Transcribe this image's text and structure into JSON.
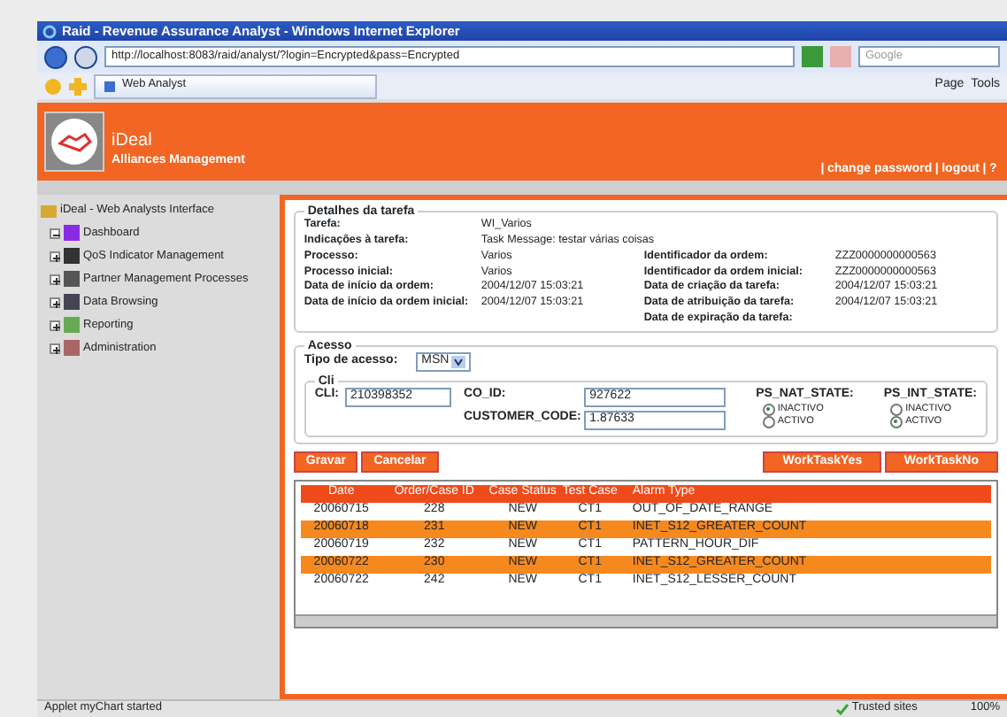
{
  "window": {
    "title": "Raid - Revenue Assurance Analyst - Windows Internet Explorer"
  },
  "address": {
    "url": "http://localhost:8083/raid/analyst/?login=Encrypted&pass=Encrypted",
    "search_placeholder": "Google"
  },
  "tab": {
    "label": "Web Analyst"
  },
  "toolbar": [
    "Page",
    "Tools"
  ],
  "header": {
    "brand": "iDeal",
    "subtitle": "Alliances Management",
    "links": [
      "change password",
      "logout",
      "?"
    ],
    "separator": "|"
  },
  "sidebar": {
    "root": "iDeal - Web Analysts Interface",
    "items": [
      {
        "label": "Dashboard",
        "expanded": true
      },
      {
        "label": "QoS Indicator Management",
        "expanded": false
      },
      {
        "label": "Partner Management Processes",
        "expanded": false
      },
      {
        "label": "Data Browsing",
        "expanded": false
      },
      {
        "label": "Reporting",
        "expanded": false
      },
      {
        "label": "Administration",
        "expanded": false
      }
    ]
  },
  "details": {
    "legend": "Detalhes da tarefa",
    "left": [
      {
        "label": "Tarefa:",
        "value": "WI_Varios"
      },
      {
        "label": "Indicações à tarefa:",
        "value": "Task Message: testar várias coisas"
      },
      {
        "label": "Processo:",
        "value": "Varios"
      },
      {
        "label": "Processo inicial:",
        "value": "Varios"
      },
      {
        "label": "Data de início da ordem:",
        "value": "2004/12/07 15:03:21"
      },
      {
        "label": "Data de início da ordem inicial:",
        "value": "2004/12/07 15:03:21"
      }
    ],
    "right": [
      {
        "label": "Identificador da ordem:",
        "value": "ZZZ0000000000563"
      },
      {
        "label": "Identificador da ordem inicial:",
        "value": "ZZZ0000000000563"
      },
      {
        "label": "Data de criação da tarefa:",
        "value": "2004/12/07 15:03:21"
      },
      {
        "label": "Data de atribuição da tarefa:",
        "value": "2004/12/07 15:03:21"
      },
      {
        "label": "Data de expiração da tarefa:"
      }
    ]
  },
  "access": {
    "legend": "Acesso",
    "type_label": "Tipo de acesso:",
    "type_value": "MSN",
    "cli": {
      "legend": "Cli",
      "cli_label": "CLI:",
      "cli_value": "210398352",
      "coid_label": "CO_ID:",
      "coid_value": "927622",
      "cc_label": "CUSTOMER_CODE:",
      "cc_value": "1.87633",
      "states": [
        {
          "label": "PS_NAT_STATE:",
          "options": [
            {
              "label": "INACTIVO",
              "selected": true
            },
            {
              "label": "ACTIVO",
              "selected": false
            }
          ]
        },
        {
          "label": "PS_INT_STATE:",
          "options": [
            {
              "label": "INACTIVO",
              "selected": false
            },
            {
              "label": "ACTIVO",
              "selected": true
            }
          ]
        }
      ]
    }
  },
  "buttons_left": [
    "Gravar",
    "Cancelar"
  ],
  "buttons_right": [
    "WorkTaskYes",
    "WorkTaskNo"
  ],
  "table": {
    "columns": [
      "Date",
      "Order/Case ID",
      "Case Status",
      "Test Case",
      "Alarm Type"
    ],
    "rows": [
      {
        "cells": [
          "20060715",
          "228",
          "NEW",
          "CT1",
          "OUT_OF_DATE_RANGE"
        ],
        "selected": false
      },
      {
        "cells": [
          "20060718",
          "231",
          "NEW",
          "CT1",
          "INET_S12_GREATER_COUNT"
        ],
        "selected": true
      },
      {
        "cells": [
          "20060719",
          "232",
          "NEW",
          "CT1",
          "PATTERN_HOUR_DIF"
        ],
        "selected": false
      },
      {
        "cells": [
          "20060722",
          "230",
          "NEW",
          "CT1",
          "INET_S12_GREATER_COUNT"
        ],
        "selected": true
      },
      {
        "cells": [
          "20060722",
          "242",
          "NEW",
          "CT1",
          "INET_S12_LESSER_COUNT"
        ],
        "selected": false
      }
    ]
  },
  "status_bar": {
    "text": "Applet myChart started",
    "zone": "Trusted sites",
    "zoom": "100%"
  }
}
